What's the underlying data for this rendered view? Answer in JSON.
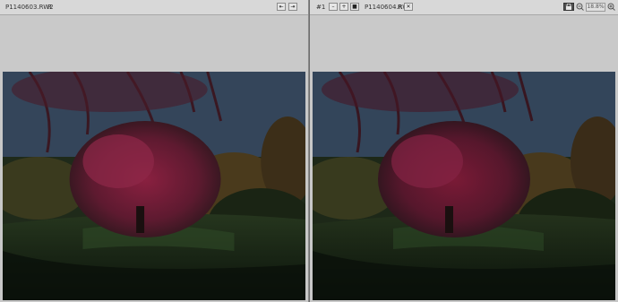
{
  "left_panel": {
    "filename": "P1140603.RW2",
    "marker": "R",
    "btn1_glyph": "⇤",
    "btn2_glyph": "⇥"
  },
  "right_panel": {
    "index": "#1",
    "btn_minus": "–",
    "btn_plus": "+",
    "btn_square": "■",
    "filename": "P1140604.RW2",
    "marker": "R",
    "close_glyph": "✕",
    "zoom_value": "18.8%"
  },
  "icons": {
    "lock": "lock-icon",
    "zoom_out": "zoom-out-icon",
    "zoom_in": "zoom-in-icon"
  },
  "colors": {
    "titlebar": "#d8d8d8",
    "pane_bg": "#c8c8c8",
    "sky": "#3a4a5e",
    "tree_red": "#7a1c35"
  }
}
